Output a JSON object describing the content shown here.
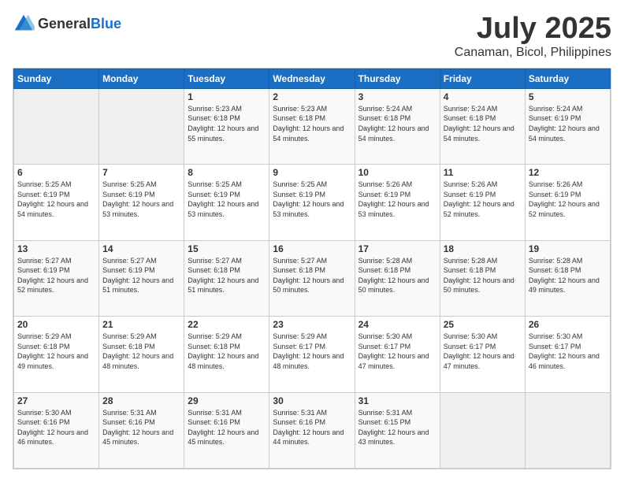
{
  "header": {
    "logo_general": "General",
    "logo_blue": "Blue",
    "month": "July 2025",
    "location": "Canaman, Bicol, Philippines"
  },
  "calendar": {
    "days_of_week": [
      "Sunday",
      "Monday",
      "Tuesday",
      "Wednesday",
      "Thursday",
      "Friday",
      "Saturday"
    ],
    "weeks": [
      [
        {
          "day": "",
          "sunrise": "",
          "sunset": "",
          "daylight": ""
        },
        {
          "day": "",
          "sunrise": "",
          "sunset": "",
          "daylight": ""
        },
        {
          "day": "1",
          "sunrise": "Sunrise: 5:23 AM",
          "sunset": "Sunset: 6:18 PM",
          "daylight": "Daylight: 12 hours and 55 minutes."
        },
        {
          "day": "2",
          "sunrise": "Sunrise: 5:23 AM",
          "sunset": "Sunset: 6:18 PM",
          "daylight": "Daylight: 12 hours and 54 minutes."
        },
        {
          "day": "3",
          "sunrise": "Sunrise: 5:24 AM",
          "sunset": "Sunset: 6:18 PM",
          "daylight": "Daylight: 12 hours and 54 minutes."
        },
        {
          "day": "4",
          "sunrise": "Sunrise: 5:24 AM",
          "sunset": "Sunset: 6:18 PM",
          "daylight": "Daylight: 12 hours and 54 minutes."
        },
        {
          "day": "5",
          "sunrise": "Sunrise: 5:24 AM",
          "sunset": "Sunset: 6:19 PM",
          "daylight": "Daylight: 12 hours and 54 minutes."
        }
      ],
      [
        {
          "day": "6",
          "sunrise": "Sunrise: 5:25 AM",
          "sunset": "Sunset: 6:19 PM",
          "daylight": "Daylight: 12 hours and 54 minutes."
        },
        {
          "day": "7",
          "sunrise": "Sunrise: 5:25 AM",
          "sunset": "Sunset: 6:19 PM",
          "daylight": "Daylight: 12 hours and 53 minutes."
        },
        {
          "day": "8",
          "sunrise": "Sunrise: 5:25 AM",
          "sunset": "Sunset: 6:19 PM",
          "daylight": "Daylight: 12 hours and 53 minutes."
        },
        {
          "day": "9",
          "sunrise": "Sunrise: 5:25 AM",
          "sunset": "Sunset: 6:19 PM",
          "daylight": "Daylight: 12 hours and 53 minutes."
        },
        {
          "day": "10",
          "sunrise": "Sunrise: 5:26 AM",
          "sunset": "Sunset: 6:19 PM",
          "daylight": "Daylight: 12 hours and 53 minutes."
        },
        {
          "day": "11",
          "sunrise": "Sunrise: 5:26 AM",
          "sunset": "Sunset: 6:19 PM",
          "daylight": "Daylight: 12 hours and 52 minutes."
        },
        {
          "day": "12",
          "sunrise": "Sunrise: 5:26 AM",
          "sunset": "Sunset: 6:19 PM",
          "daylight": "Daylight: 12 hours and 52 minutes."
        }
      ],
      [
        {
          "day": "13",
          "sunrise": "Sunrise: 5:27 AM",
          "sunset": "Sunset: 6:19 PM",
          "daylight": "Daylight: 12 hours and 52 minutes."
        },
        {
          "day": "14",
          "sunrise": "Sunrise: 5:27 AM",
          "sunset": "Sunset: 6:19 PM",
          "daylight": "Daylight: 12 hours and 51 minutes."
        },
        {
          "day": "15",
          "sunrise": "Sunrise: 5:27 AM",
          "sunset": "Sunset: 6:18 PM",
          "daylight": "Daylight: 12 hours and 51 minutes."
        },
        {
          "day": "16",
          "sunrise": "Sunrise: 5:27 AM",
          "sunset": "Sunset: 6:18 PM",
          "daylight": "Daylight: 12 hours and 50 minutes."
        },
        {
          "day": "17",
          "sunrise": "Sunrise: 5:28 AM",
          "sunset": "Sunset: 6:18 PM",
          "daylight": "Daylight: 12 hours and 50 minutes."
        },
        {
          "day": "18",
          "sunrise": "Sunrise: 5:28 AM",
          "sunset": "Sunset: 6:18 PM",
          "daylight": "Daylight: 12 hours and 50 minutes."
        },
        {
          "day": "19",
          "sunrise": "Sunrise: 5:28 AM",
          "sunset": "Sunset: 6:18 PM",
          "daylight": "Daylight: 12 hours and 49 minutes."
        }
      ],
      [
        {
          "day": "20",
          "sunrise": "Sunrise: 5:29 AM",
          "sunset": "Sunset: 6:18 PM",
          "daylight": "Daylight: 12 hours and 49 minutes."
        },
        {
          "day": "21",
          "sunrise": "Sunrise: 5:29 AM",
          "sunset": "Sunset: 6:18 PM",
          "daylight": "Daylight: 12 hours and 48 minutes."
        },
        {
          "day": "22",
          "sunrise": "Sunrise: 5:29 AM",
          "sunset": "Sunset: 6:18 PM",
          "daylight": "Daylight: 12 hours and 48 minutes."
        },
        {
          "day": "23",
          "sunrise": "Sunrise: 5:29 AM",
          "sunset": "Sunset: 6:17 PM",
          "daylight": "Daylight: 12 hours and 48 minutes."
        },
        {
          "day": "24",
          "sunrise": "Sunrise: 5:30 AM",
          "sunset": "Sunset: 6:17 PM",
          "daylight": "Daylight: 12 hours and 47 minutes."
        },
        {
          "day": "25",
          "sunrise": "Sunrise: 5:30 AM",
          "sunset": "Sunset: 6:17 PM",
          "daylight": "Daylight: 12 hours and 47 minutes."
        },
        {
          "day": "26",
          "sunrise": "Sunrise: 5:30 AM",
          "sunset": "Sunset: 6:17 PM",
          "daylight": "Daylight: 12 hours and 46 minutes."
        }
      ],
      [
        {
          "day": "27",
          "sunrise": "Sunrise: 5:30 AM",
          "sunset": "Sunset: 6:16 PM",
          "daylight": "Daylight: 12 hours and 46 minutes."
        },
        {
          "day": "28",
          "sunrise": "Sunrise: 5:31 AM",
          "sunset": "Sunset: 6:16 PM",
          "daylight": "Daylight: 12 hours and 45 minutes."
        },
        {
          "day": "29",
          "sunrise": "Sunrise: 5:31 AM",
          "sunset": "Sunset: 6:16 PM",
          "daylight": "Daylight: 12 hours and 45 minutes."
        },
        {
          "day": "30",
          "sunrise": "Sunrise: 5:31 AM",
          "sunset": "Sunset: 6:16 PM",
          "daylight": "Daylight: 12 hours and 44 minutes."
        },
        {
          "day": "31",
          "sunrise": "Sunrise: 5:31 AM",
          "sunset": "Sunset: 6:15 PM",
          "daylight": "Daylight: 12 hours and 43 minutes."
        },
        {
          "day": "",
          "sunrise": "",
          "sunset": "",
          "daylight": ""
        },
        {
          "day": "",
          "sunrise": "",
          "sunset": "",
          "daylight": ""
        }
      ]
    ]
  }
}
